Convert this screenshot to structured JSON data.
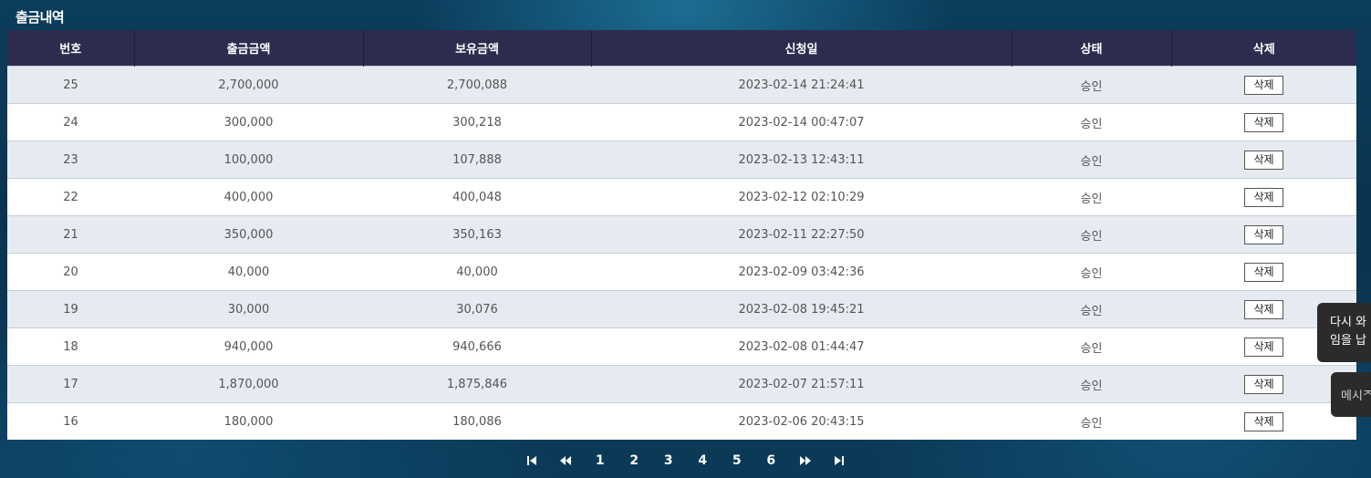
{
  "section": {
    "title": "출금내역"
  },
  "table": {
    "columns": [
      "번호",
      "출금금액",
      "보유금액",
      "신청일",
      "상태",
      "삭제"
    ],
    "rows": [
      {
        "no": "25",
        "amount": "2,700,000",
        "balance": "2,700,088",
        "date": "2023-02-14 21:24:41",
        "status": "승인",
        "delete_label": "삭제"
      },
      {
        "no": "24",
        "amount": "300,000",
        "balance": "300,218",
        "date": "2023-02-14 00:47:07",
        "status": "승인",
        "delete_label": "삭제"
      },
      {
        "no": "23",
        "amount": "100,000",
        "balance": "107,888",
        "date": "2023-02-13 12:43:11",
        "status": "승인",
        "delete_label": "삭제"
      },
      {
        "no": "22",
        "amount": "400,000",
        "balance": "400,048",
        "date": "2023-02-12 02:10:29",
        "status": "승인",
        "delete_label": "삭제"
      },
      {
        "no": "21",
        "amount": "350,000",
        "balance": "350,163",
        "date": "2023-02-11 22:27:50",
        "status": "승인",
        "delete_label": "삭제"
      },
      {
        "no": "20",
        "amount": "40,000",
        "balance": "40,000",
        "date": "2023-02-09 03:42:36",
        "status": "승인",
        "delete_label": "삭제"
      },
      {
        "no": "19",
        "amount": "30,000",
        "balance": "30,076",
        "date": "2023-02-08 19:45:21",
        "status": "승인",
        "delete_label": "삭제"
      },
      {
        "no": "18",
        "amount": "940,000",
        "balance": "940,666",
        "date": "2023-02-08 01:44:47",
        "status": "승인",
        "delete_label": "삭제"
      },
      {
        "no": "17",
        "amount": "1,870,000",
        "balance": "1,875,846",
        "date": "2023-02-07 21:57:11",
        "status": "승인",
        "delete_label": "삭제"
      },
      {
        "no": "16",
        "amount": "180,000",
        "balance": "180,086",
        "date": "2023-02-06 20:43:15",
        "status": "승인",
        "delete_label": "삭제"
      }
    ]
  },
  "pagination": {
    "first_icon": "skip-first-icon",
    "prev_icon": "rewind-icon",
    "pages": [
      "1",
      "2",
      "3",
      "4",
      "5",
      "6"
    ],
    "next_icon": "fast-forward-icon",
    "last_icon": "skip-last-icon"
  },
  "toasts": [
    {
      "lines": [
        "다시 와",
        "임을 납"
      ]
    },
    {
      "lines": [
        "메시ᄌ"
      ]
    }
  ],
  "colors": {
    "header_bg": "#2e2c4e",
    "row_alt": "#e6eaf1",
    "row": "#ffffff",
    "text": "#555555",
    "toast_bg": "#2b2b2b"
  }
}
